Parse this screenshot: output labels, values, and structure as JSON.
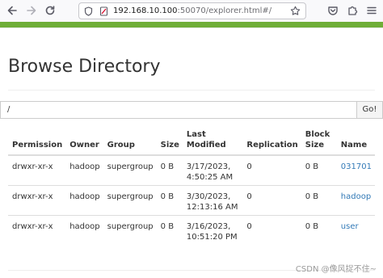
{
  "browser": {
    "url_host": "192.168.10.100",
    "url_rest": ":50070/explorer.html#/",
    "accent_color": "#6fae37"
  },
  "page": {
    "title": "Browse Directory",
    "path_value": "/",
    "go_label": "Go!"
  },
  "table": {
    "headers": {
      "permission": "Permission",
      "owner": "Owner",
      "group": "Group",
      "size": "Size",
      "last_modified": "Last Modified",
      "replication": "Replication",
      "block_size": "Block Size",
      "name": "Name"
    },
    "rows": [
      {
        "permission": "drwxr-xr-x",
        "owner": "hadoop",
        "group": "supergroup",
        "size": "0 B",
        "last_modified": "3/17/2023, 4:50:25 AM",
        "replication": "0",
        "block_size": "0 B",
        "name": "031701"
      },
      {
        "permission": "drwxr-xr-x",
        "owner": "hadoop",
        "group": "supergroup",
        "size": "0 B",
        "last_modified": "3/30/2023, 12:13:16 AM",
        "replication": "0",
        "block_size": "0 B",
        "name": "hadoop"
      },
      {
        "permission": "drwxr-xr-x",
        "owner": "hadoop",
        "group": "supergroup",
        "size": "0 B",
        "last_modified": "3/16/2023, 10:51:20 PM",
        "replication": "0",
        "block_size": "0 B",
        "name": "user"
      }
    ]
  },
  "watermark": "CSDN @像风捉不住~"
}
